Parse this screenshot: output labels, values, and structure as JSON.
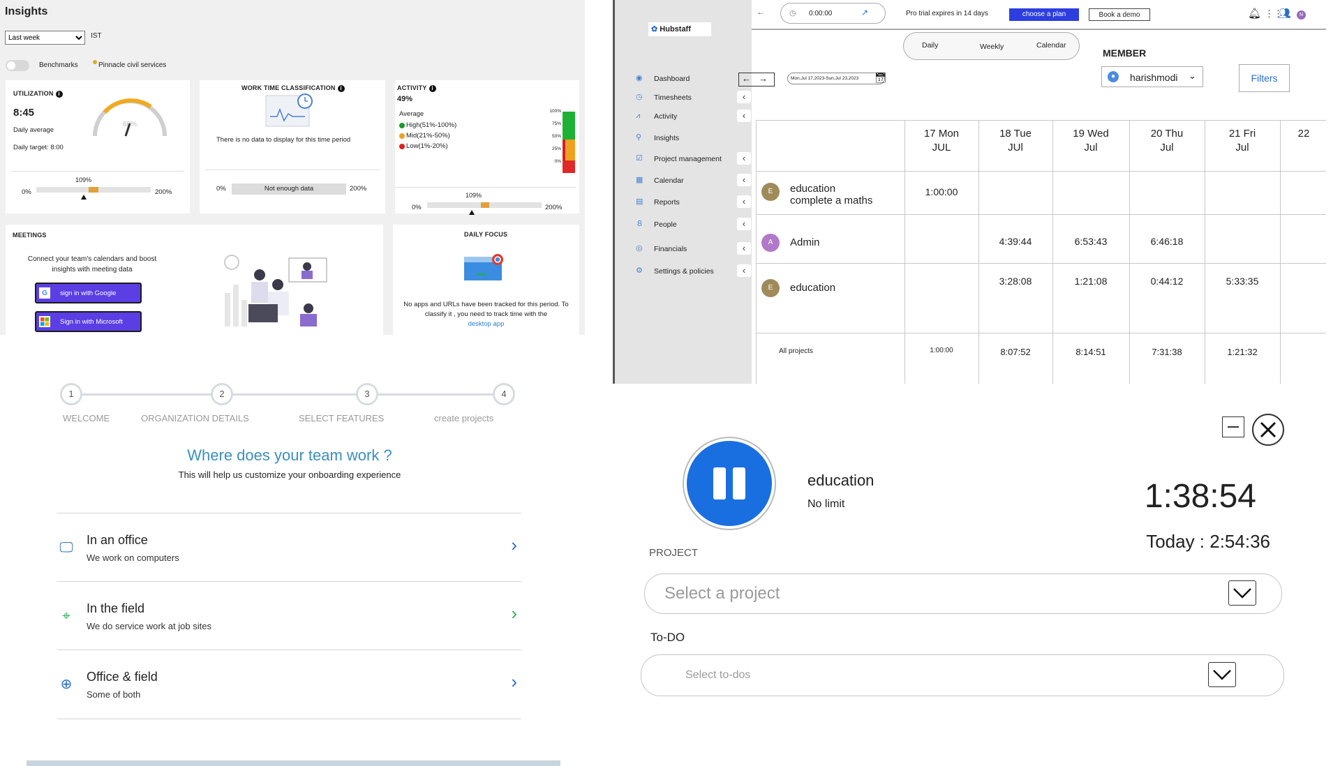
{
  "insights": {
    "title": "Insights",
    "range_options": [
      "Last week"
    ],
    "range_selected": "Last week",
    "timezone": "IST",
    "benchmarks_label": "Benchmarks",
    "org_name": "Pinnacle civil services",
    "utilization": {
      "title": "UTILIZATION",
      "value": "8:45",
      "daily_avg_label": "Daily average",
      "daily_target_label": "Daily target: 8:00",
      "gauge_label": "60%",
      "bar_pct_label": "109%",
      "bar_value": 1.09,
      "min_label": "0%",
      "max_label": "200%"
    },
    "work_time": {
      "title": "WORK TIME CLASSIFICATION",
      "empty_text": "There is no data to display for this time period",
      "bar_label": "Not enough data",
      "min_label": "0%",
      "max_label": "200%"
    },
    "activity": {
      "title": "ACTIVITY",
      "value": "49%",
      "avg_label": "Average",
      "legend": [
        {
          "label": "High(51%-100%)",
          "color": "#1a9a2a"
        },
        {
          "label": "Mid(21%-50%)",
          "color": "#f0a020"
        },
        {
          "label": "Low(1%-20%)",
          "color": "#e02020"
        }
      ],
      "scale": [
        "100%",
        "75%",
        "50%",
        "25%",
        "0%"
      ],
      "bar_pct_label": "109%",
      "bar_value": 1.09,
      "min_label": "0%",
      "max_label": "200%"
    },
    "meetings": {
      "title": "MEETINGS",
      "text": "Connect your team's calendars and boost insights with meeting data",
      "google_btn": "sign in with Google",
      "microsoft_btn": "Sign in with Microsoft"
    },
    "daily_focus": {
      "title": "DAILY FOCUS",
      "text": "No apps and URLs have been tracked for this period. To classify it , you need to track time with the",
      "link": "desktop app"
    }
  },
  "hubstaff": {
    "brand": "Hubstaff",
    "timer_value": "0:00:00",
    "trial_text": "Pro trial expires in 14 days",
    "choose_plan": "choose a plan",
    "book_demo": "Book a demo",
    "view_tabs": [
      "Daily",
      "Weekly",
      "Calendar"
    ],
    "member_label": "MEMBER",
    "member_name": "harishmodi",
    "filters": "Filters",
    "date_range": "Mon,Jul 17,2023-Sun,Jul 23,2023",
    "sidebar": [
      {
        "label": "Dashboard",
        "icon": "dashboard-icon",
        "chev": false
      },
      {
        "label": "Timesheets",
        "icon": "clock-icon",
        "chev": true
      },
      {
        "label": "Activity",
        "icon": "activity-icon",
        "chev": true
      },
      {
        "label": "Insights",
        "icon": "insights-icon",
        "chev": false
      },
      {
        "label": "Project management",
        "icon": "project-icon",
        "chev": true
      },
      {
        "label": "Calendar",
        "icon": "calendar-icon",
        "chev": true
      },
      {
        "label": "Reports",
        "icon": "reports-icon",
        "chev": true
      },
      {
        "label": "People",
        "icon": "people-icon",
        "chev": true
      },
      {
        "label": "Financials",
        "icon": "financials-icon",
        "chev": true
      },
      {
        "label": "Settings & policies",
        "icon": "settings-icon",
        "chev": true
      }
    ],
    "days": [
      {
        "l1": "17 Mon",
        "l2": "JUL"
      },
      {
        "l1": "18  Tue",
        "l2": "JUl"
      },
      {
        "l1": "19  Wed",
        "l2": "Jul"
      },
      {
        "l1": "20  Thu",
        "l2": "Jul"
      },
      {
        "l1": "21  Fri",
        "l2": "Jul"
      },
      {
        "l1": "22",
        "l2": ""
      }
    ],
    "rows": [
      {
        "avatar": "E",
        "avatar_color": "#a08a5a",
        "name": "education\ncomplete a maths",
        "cells": [
          "1:00:00",
          "",
          "",
          "",
          "",
          ""
        ]
      },
      {
        "avatar": "A",
        "avatar_color": "#b07ac8",
        "name": "Admin",
        "cells": [
          "",
          "4:39:44",
          "6:53:43",
          "6:46:18",
          "",
          ""
        ]
      },
      {
        "avatar": "E",
        "avatar_color": "#a08a5a",
        "name": "education",
        "cells": [
          "",
          "3:28:08",
          "1:21:08",
          "0:44:12",
          "5:33:35",
          ""
        ]
      }
    ],
    "totals_label": "All projects",
    "totals": [
      "1:00:00",
      "8:07:52",
      "8:14:51",
      "7:31:38",
      "1:21:32",
      ""
    ]
  },
  "onboarding": {
    "steps": [
      {
        "num": "1",
        "label": "WELCOME"
      },
      {
        "num": "2",
        "label": "ORGANIZATION DETAILS"
      },
      {
        "num": "3",
        "label": "SELECT FEATURES"
      },
      {
        "num": "4",
        "label": "create projects"
      }
    ],
    "heading": "Where does your team work ?",
    "subheading": "This will help us customize your onboarding experience",
    "options": [
      {
        "title": "In an office",
        "sub": "We work on computers",
        "icon": "monitor-icon"
      },
      {
        "title": "In the field",
        "sub": "We do service work at job sites",
        "icon": "location-pin-icon"
      },
      {
        "title": "Office & field",
        "sub": "Some of both",
        "icon": "plus-circle-icon"
      }
    ]
  },
  "timer": {
    "project_name": "education",
    "limit": "No limit",
    "elapsed": "1:38:54",
    "today": "Today : 2:54:36",
    "project_label": "PROJECT",
    "project_placeholder": "Select a project",
    "todo_label": "To-DO",
    "todo_placeholder": "Select to-dos"
  }
}
